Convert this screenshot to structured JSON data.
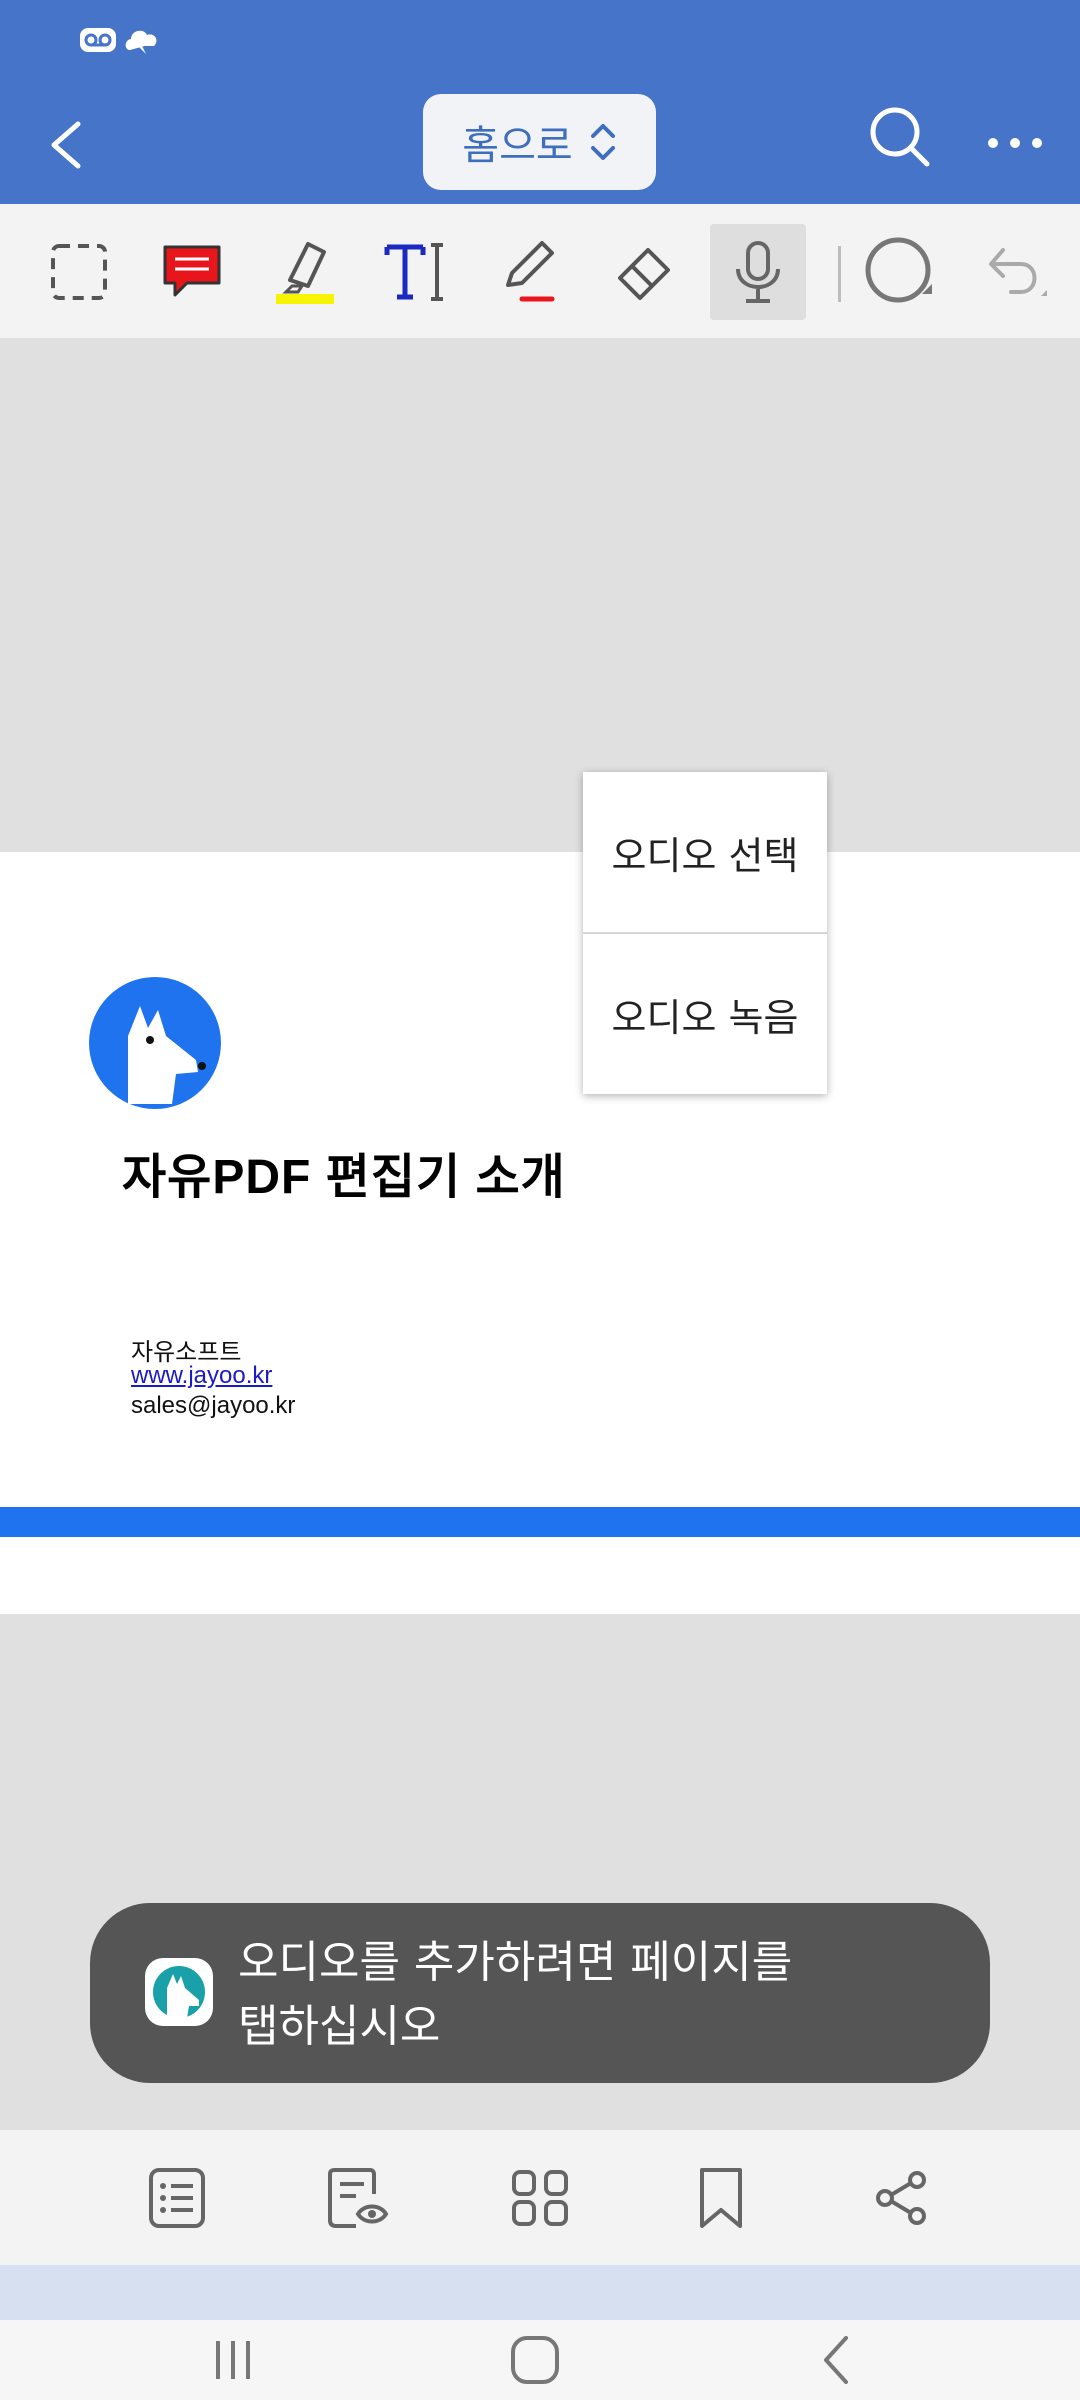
{
  "app": {
    "title_pill": "홈으로",
    "accent_color": "#4674c8"
  },
  "status_bar": {
    "icons": [
      "voicemail-icon",
      "cloud-sync-icon"
    ]
  },
  "topbar": {
    "back_icon": "chevron-left-icon",
    "search_icon": "search-icon",
    "more_icon": "more-horizontal-icon"
  },
  "toolbar": {
    "tools": [
      "selection-box-icon",
      "sticky-note-icon",
      "highlighter-icon",
      "text-tool-icon",
      "pencil-icon",
      "eraser-icon",
      "microphone-icon",
      "shape-circle-icon",
      "undo-icon"
    ],
    "active_tool": "microphone-icon"
  },
  "document": {
    "title": "자유PDF 편집기 소개",
    "company": "자유소프트",
    "link": "www.jayoo.kr",
    "email": "sales@jayoo.kr"
  },
  "popup_menu": {
    "items": [
      {
        "label": "오디오 선택"
      },
      {
        "label": "오디오 녹음"
      }
    ]
  },
  "toast": {
    "line1": "오디오를 추가하려면 페이지를",
    "line2": "탭하십시오"
  },
  "bottom_bar": {
    "buttons": [
      "outline-list-icon",
      "review-icon",
      "thumbnails-grid-icon",
      "bookmark-icon",
      "share-icon"
    ]
  },
  "nav_bar": {
    "buttons": [
      "recents-icon",
      "home-icon",
      "back-icon"
    ]
  }
}
